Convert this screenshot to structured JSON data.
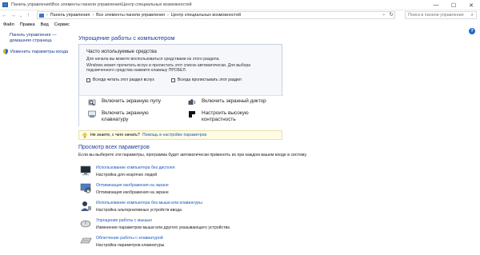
{
  "titlebar": {
    "title": "Панель управления\\Все элементы панели управления\\Центр специальных возможностей",
    "minimize": "—",
    "maximize": "☐",
    "close": "✕"
  },
  "nav": {
    "back": "←",
    "forward": "→",
    "recent": "⌄",
    "up": "↑"
  },
  "address": {
    "crumbs": [
      "Панель управления",
      "Все элементы панели управления",
      "Центр специальных возможностей"
    ],
    "separator": "›",
    "dropdown": "⌄",
    "refresh": "↻"
  },
  "search": {
    "placeholder": "Поиск в панели управления",
    "icon": "search-icon"
  },
  "menubar": {
    "items": [
      "Файл",
      "Правка",
      "Вид",
      "Сервис"
    ]
  },
  "help": "?",
  "sidebar": {
    "home": "Панель управления — домашняя страница",
    "item": "Изменить параметры входа"
  },
  "main": {
    "title": "Упрощение работы с компьютером",
    "quick": {
      "title": "Часто используемые средства",
      "desc1": "Для начала вы можете воспользоваться средствами из этого раздела.",
      "desc2": "Windows может прочитать вслух и пролистать этот список автоматически. Для выбора подсвеченного средства нажмите клавишу ПРОБЕЛ.",
      "check_read": "Всегда читать этот раздел вслух",
      "check_scan": "Всегда пролистывать этот раздел",
      "tools": {
        "magnifier": "Включить экранную лупу",
        "narrator": "Включить экранный диктор",
        "keyboard": "Включить экранную клавиатуру",
        "contrast": "Настроить высокую контрастность"
      }
    },
    "tip": {
      "text": "Не знаете, с чего начать?",
      "link": "Помощь в настройке параметров"
    },
    "all": {
      "title": "Просмотр всех параметров",
      "desc": "Если вы выберете эти параметры, программа будет автоматически применять их при каждом вашем входе в систему."
    },
    "rows": [
      {
        "link": "Использование компьютера без дисплея",
        "desc": "Настройка для незрячих людей"
      },
      {
        "link": "Оптимизация изображения на экране",
        "desc": "Оптимизация изображения на экране"
      },
      {
        "link": "Использование компьютера без мыши или клавиатуры",
        "desc": "Настройка альтернативных устройств ввода"
      },
      {
        "link": "Упрощение работы с мышью",
        "desc": "Изменение параметров мыши или другого указывающего устройства"
      },
      {
        "link": "Облегчение работы с клавиатурой",
        "desc": "Настройка параметров клавиатуры"
      }
    ]
  },
  "colors": {
    "link": "#1e5ab8",
    "heading": "#1e3d96",
    "tip_bg": "#fffce6"
  }
}
